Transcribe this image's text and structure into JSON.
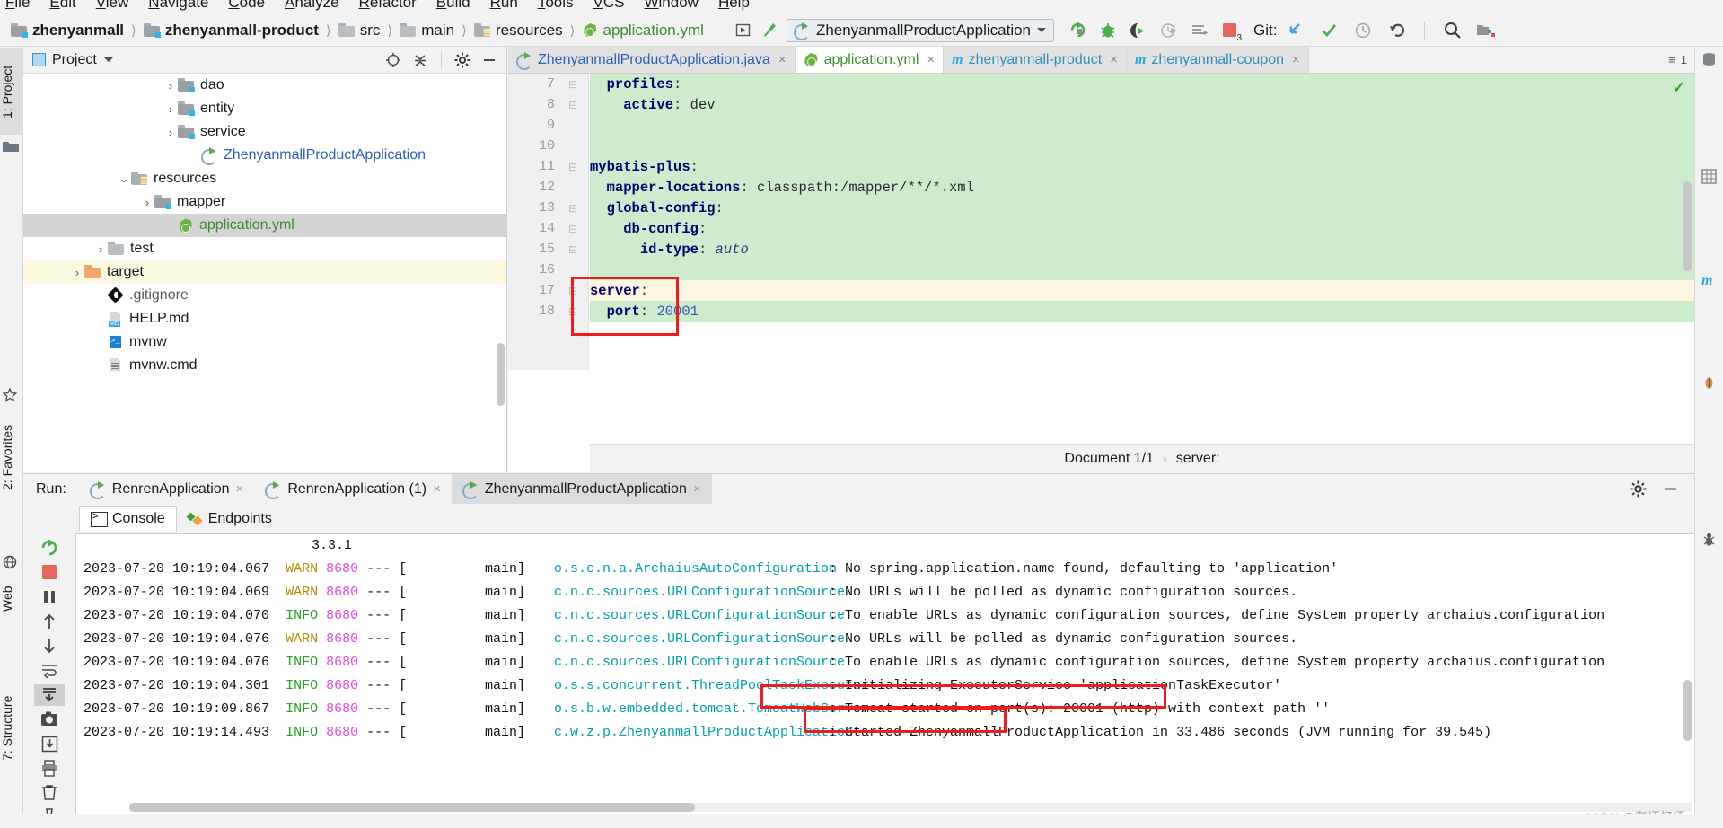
{
  "menu": {
    "items": [
      "File",
      "Edit",
      "View",
      "Navigate",
      "Code",
      "Analyze",
      "Refactor",
      "Build",
      "Run",
      "Tools",
      "VCS",
      "Window",
      "Help"
    ]
  },
  "toolbar": {
    "breadcrumbs": [
      {
        "label": "zhenyanmall",
        "icon": "module-folder-icon",
        "bold": true,
        "color": "#1a1a1a"
      },
      {
        "label": "zhenyanmall-product",
        "icon": "module-folder-icon",
        "bold": true,
        "color": "#1a1a1a"
      },
      {
        "label": "src",
        "icon": "folder-icon",
        "bold": false,
        "color": "#1a1a1a"
      },
      {
        "label": "main",
        "icon": "folder-icon",
        "bold": false,
        "color": "#1a1a1a"
      },
      {
        "label": "resources",
        "icon": "resources-folder-icon",
        "bold": false,
        "color": "#1a1a1a"
      },
      {
        "label": "application.yml",
        "icon": "spring-leaf-icon",
        "bold": false,
        "color": "#3a8a2e"
      }
    ],
    "run_configuration": "ZhenyanmallProductApplication",
    "git_label": "Git:",
    "icons": [
      "build-project-icon",
      "hammer-icon",
      "rerun-icon",
      "debug-icon",
      "run-with-coverage-icon",
      "profiler-icon",
      "run-dashboard-icon",
      "stop-icon",
      "update-project-icon",
      "commit-icon",
      "history-icon",
      "rollback-icon",
      "search-everywhere-icon",
      "project-structure-icon"
    ],
    "stop_badge": "3"
  },
  "left_strip": {
    "tabs": [
      {
        "label": "1: Project",
        "selected": true
      },
      {
        "label": "2: Favorites",
        "selected": false
      },
      {
        "label": "Web",
        "selected": false
      },
      {
        "label": "7: Structure",
        "selected": false
      }
    ]
  },
  "right_strip": {
    "tabs": [
      "Database",
      "SciView",
      "Maven",
      "Bean Validation",
      "Ant Build"
    ]
  },
  "project_panel": {
    "title": "Project",
    "header_icons": [
      "locate-icon",
      "collapse-all-icon",
      "settings-gear-icon",
      "hide-icon"
    ],
    "tree": [
      {
        "label": "dao",
        "indent": 6,
        "arrow": "›",
        "icon": "package-folder-icon",
        "state": "normal",
        "color": "dark"
      },
      {
        "label": "entity",
        "indent": 6,
        "arrow": "›",
        "icon": "package-folder-icon",
        "state": "normal",
        "color": "dark"
      },
      {
        "label": "service",
        "indent": 6,
        "arrow": "›",
        "icon": "package-folder-icon",
        "state": "normal",
        "color": "dark"
      },
      {
        "label": "ZhenyanmallProductApplication",
        "indent": 7,
        "arrow": "",
        "icon": "spring-boot-class-icon",
        "state": "normal",
        "color": "blue"
      },
      {
        "label": "resources",
        "indent": 4,
        "arrow": "⌄",
        "icon": "resources-folder-icon",
        "state": "normal",
        "color": "dark"
      },
      {
        "label": "mapper",
        "indent": 5,
        "arrow": "›",
        "icon": "package-folder-icon",
        "state": "normal",
        "color": "dark"
      },
      {
        "label": "application.yml",
        "indent": 6,
        "arrow": "",
        "icon": "spring-leaf-icon",
        "state": "selected",
        "color": "green"
      },
      {
        "label": "test",
        "indent": 3,
        "arrow": "›",
        "icon": "folder-icon",
        "state": "normal",
        "color": "dark"
      },
      {
        "label": "target",
        "indent": 2,
        "arrow": "›",
        "icon": "orange-folder-icon",
        "state": "highlight",
        "color": "dark"
      },
      {
        "label": ".gitignore",
        "indent": 3,
        "arrow": "",
        "icon": "git-icon",
        "state": "normal",
        "color": "grey"
      },
      {
        "label": "HELP.md",
        "indent": 3,
        "arrow": "",
        "icon": "markdown-icon",
        "state": "normal",
        "color": "dark"
      },
      {
        "label": "mvnw",
        "indent": 3,
        "arrow": "",
        "icon": "shell-script-icon",
        "state": "normal",
        "color": "dark"
      },
      {
        "label": "mvnw.cmd",
        "indent": 3,
        "arrow": "",
        "icon": "document-icon",
        "state": "normal",
        "color": "dark"
      }
    ]
  },
  "editor": {
    "tabs": [
      {
        "label": "ZhenyanmallProductApplication.java",
        "icon": "spring-boot-class-icon",
        "color": "blue",
        "active": false
      },
      {
        "label": "application.yml",
        "icon": "spring-leaf-icon",
        "color": "green",
        "active": true
      },
      {
        "label": "zhenyanmall-product",
        "icon": "maven-icon",
        "color": "cyan",
        "active": false
      },
      {
        "label": "zhenyanmall-coupon",
        "icon": "maven-icon",
        "color": "cyan",
        "active": false
      }
    ],
    "tabs_overflow": "1",
    "lines": [
      {
        "n": "7",
        "fold": "⊟",
        "indent": 2,
        "segments": [
          {
            "t": "profiles",
            "c": "key"
          },
          {
            "t": ":",
            "c": "val"
          }
        ],
        "bg": "green"
      },
      {
        "n": "8",
        "fold": "⊟",
        "indent": 4,
        "segments": [
          {
            "t": "active",
            "c": "key"
          },
          {
            "t": ": ",
            "c": "val"
          },
          {
            "t": "dev",
            "c": "val"
          }
        ],
        "bg": "green"
      },
      {
        "n": "9",
        "fold": "",
        "indent": 0,
        "segments": [],
        "bg": "green"
      },
      {
        "n": "10",
        "fold": "",
        "indent": 0,
        "segments": [],
        "bg": "green"
      },
      {
        "n": "11",
        "fold": "⊟",
        "indent": 0,
        "segments": [
          {
            "t": "mybatis-plus",
            "c": "key"
          },
          {
            "t": ":",
            "c": "val"
          }
        ],
        "bg": "green"
      },
      {
        "n": "12",
        "fold": "",
        "indent": 2,
        "segments": [
          {
            "t": "mapper-locations",
            "c": "key"
          },
          {
            "t": ": ",
            "c": "val"
          },
          {
            "t": "classpath:/mapper/**/*.xml",
            "c": "val"
          }
        ],
        "bg": "green"
      },
      {
        "n": "13",
        "fold": "⊟",
        "indent": 2,
        "segments": [
          {
            "t": "global-config",
            "c": "key"
          },
          {
            "t": ":",
            "c": "val"
          }
        ],
        "bg": "green"
      },
      {
        "n": "14",
        "fold": "⊟",
        "indent": 4,
        "segments": [
          {
            "t": "db-config",
            "c": "key"
          },
          {
            "t": ":",
            "c": "val"
          }
        ],
        "bg": "green"
      },
      {
        "n": "15",
        "fold": "⊟",
        "indent": 6,
        "segments": [
          {
            "t": "id-type",
            "c": "key"
          },
          {
            "t": ": ",
            "c": "val"
          },
          {
            "t": "auto",
            "c": "ital"
          }
        ],
        "bg": "green"
      },
      {
        "n": "16",
        "fold": "",
        "indent": 0,
        "segments": [],
        "bg": "green"
      },
      {
        "n": "17",
        "fold": "⊟",
        "indent": 0,
        "segments": [
          {
            "t": "server",
            "c": "key"
          },
          {
            "t": ":",
            "c": "val"
          }
        ],
        "bg": "yellow"
      },
      {
        "n": "18",
        "fold": "⊟",
        "indent": 2,
        "segments": [
          {
            "t": "port",
            "c": "key"
          },
          {
            "t": ": ",
            "c": "val"
          },
          {
            "t": "20001",
            "c": "num"
          }
        ],
        "bg": "green"
      }
    ],
    "breadcrumb": {
      "document": "Document 1/1",
      "separator": "›",
      "node": "server:"
    },
    "inspection_status": "✓"
  },
  "run_panel": {
    "label": "Run:",
    "tabs": [
      {
        "label": "RenrenApplication",
        "active": false
      },
      {
        "label": "RenrenApplication (1)",
        "active": false
      },
      {
        "label": "ZhenyanmallProductApplication",
        "active": true
      }
    ],
    "header_icons": [
      "settings-gear-icon",
      "hide-panel-icon"
    ],
    "sub_tabs": [
      {
        "label": "Console",
        "icon": "console-icon",
        "active": true
      },
      {
        "label": "Endpoints",
        "icon": "endpoints-icon",
        "active": false
      }
    ],
    "side_icons": [
      "rerun-icon",
      "stop-icon",
      "pause-icon",
      "scroll-up-icon",
      "scroll-down-icon",
      "soft-wrap-icon",
      "scroll-to-end-icon",
      "camera-icon",
      "export-icon",
      "print-icon",
      "clear-all-icon",
      "pin-icon"
    ],
    "version_line": "3.3.1",
    "log_lines": [
      {
        "ts": "2023-07-20 10:19:04.067",
        "level": "WARN",
        "pid": "8680",
        "thread": "main]",
        "logger": "o.s.c.n.a.ArchaiusAutoConfiguration",
        "msg": "No spring.application.name found, defaulting to 'application'"
      },
      {
        "ts": "2023-07-20 10:19:04.069",
        "level": "WARN",
        "pid": "8680",
        "thread": "main]",
        "logger": "c.n.c.sources.URLConfigurationSource",
        "msg": "No URLs will be polled as dynamic configuration sources."
      },
      {
        "ts": "2023-07-20 10:19:04.070",
        "level": "INFO",
        "pid": "8680",
        "thread": "main]",
        "logger": "c.n.c.sources.URLConfigurationSource",
        "msg": "To enable URLs as dynamic configuration sources, define System property archaius.configuration"
      },
      {
        "ts": "2023-07-20 10:19:04.076",
        "level": "WARN",
        "pid": "8680",
        "thread": "main]",
        "logger": "c.n.c.sources.URLConfigurationSource",
        "msg": "No URLs will be polled as dynamic configuration sources."
      },
      {
        "ts": "2023-07-20 10:19:04.076",
        "level": "INFO",
        "pid": "8680",
        "thread": "main]",
        "logger": "c.n.c.sources.URLConfigurationSource",
        "msg": "To enable URLs as dynamic configuration sources, define System property archaius.configuration"
      },
      {
        "ts": "2023-07-20 10:19:04.301",
        "level": "INFO",
        "pid": "8680",
        "thread": "main]",
        "logger": "o.s.s.concurrent.ThreadPoolTaskExecutor",
        "msg": "Initializing ExecutorService 'applicationTaskExecutor'"
      },
      {
        "ts": "2023-07-20 10:19:09.867",
        "level": "INFO",
        "pid": "8680",
        "thread": "main]",
        "logger": "o.s.b.w.embedded.tomcat.TomcatWebServer",
        "msg": "Tomcat started on port(s): 20001 (http) with context path ''"
      },
      {
        "ts": "2023-07-20 10:19:14.493",
        "level": "INFO",
        "pid": "8680",
        "thread": "main]",
        "logger": "c.w.z.p.ZhenyanmallProductApplication",
        "msg": "Started ZhenyanmallProductApplication in 33.486 seconds (JVM running for 39.545)"
      }
    ]
  },
  "watermark": "CSDN @有语忆语",
  "colors": {
    "accent_green": "#6db33f",
    "highlight_red": "#f21b1b",
    "diff_green_bg": "#cdeccd",
    "caret_row_bg": "#fdf7e2",
    "link_blue": "#2f5fb8",
    "logger_cyan": "#00a0b0"
  }
}
